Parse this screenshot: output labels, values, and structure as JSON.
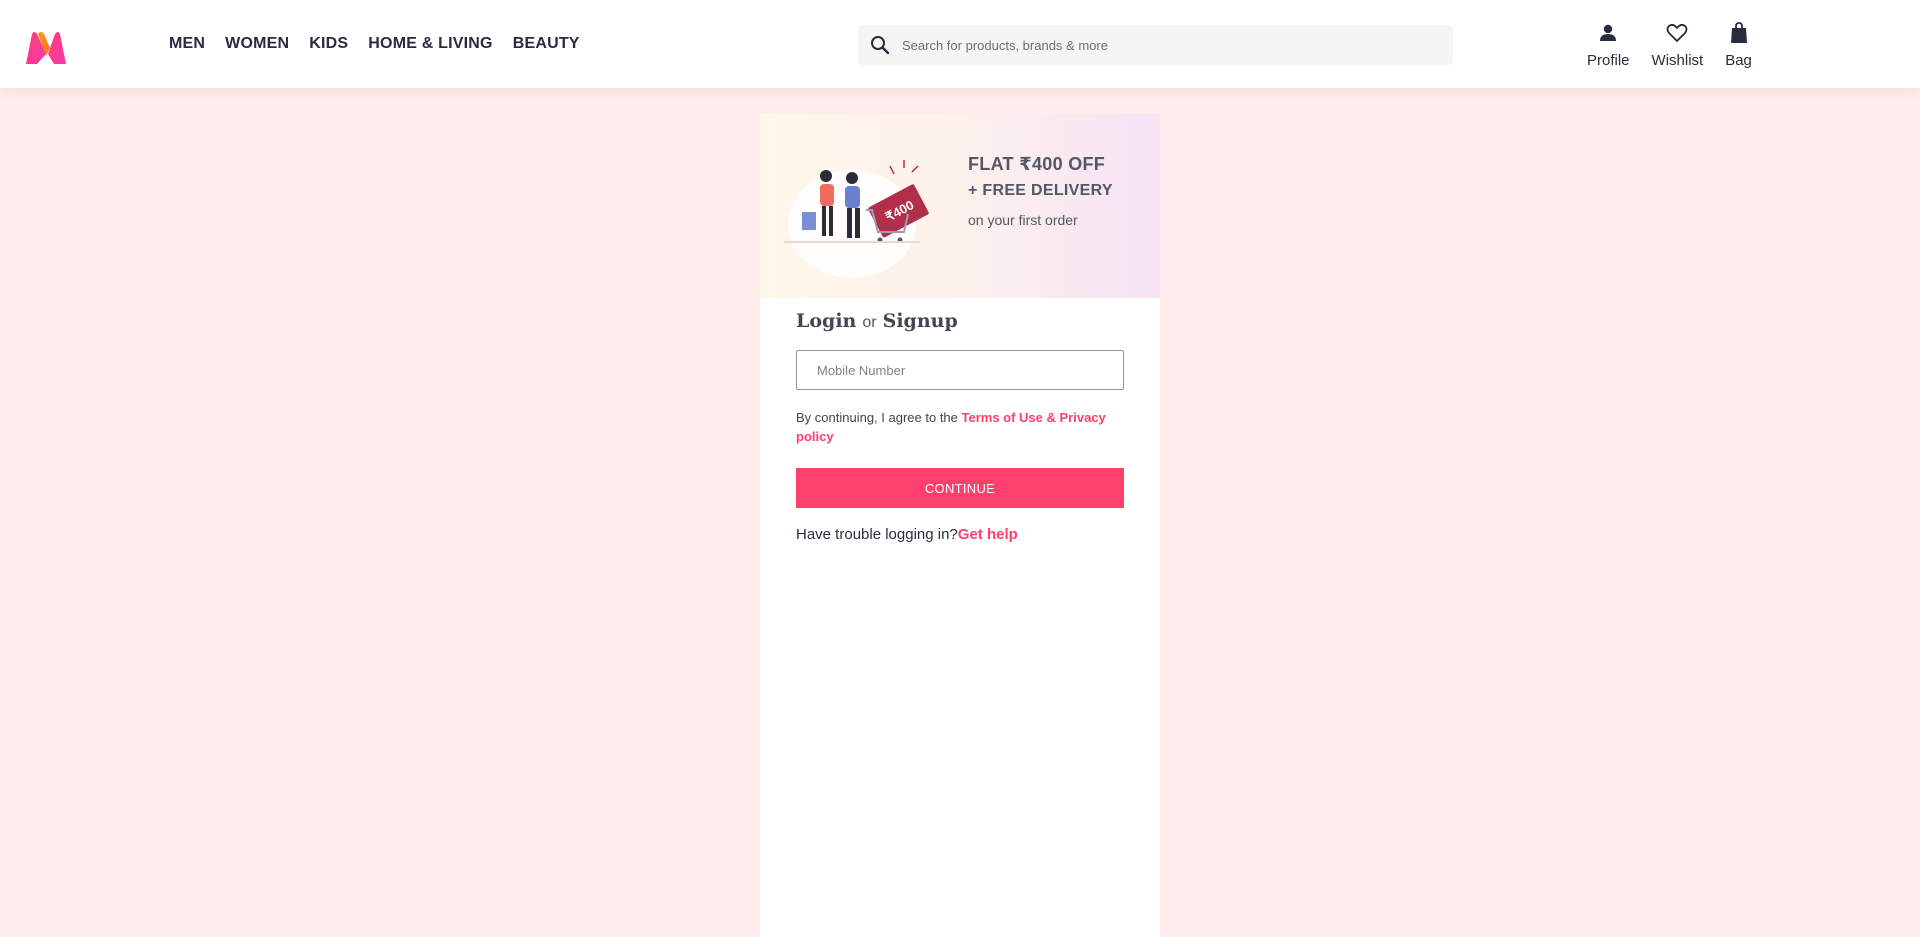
{
  "header": {
    "logo_icon": "myntra-logo-icon",
    "nav": [
      {
        "label": "MEN"
      },
      {
        "label": "WOMEN"
      },
      {
        "label": "KIDS"
      },
      {
        "label": "HOME & LIVING"
      },
      {
        "label": "BEAUTY"
      }
    ],
    "search": {
      "icon": "search-icon",
      "placeholder": "Search for products, brands & more"
    },
    "actions": [
      {
        "label": "Profile",
        "icon": "profile-icon"
      },
      {
        "label": "Wishlist",
        "icon": "heart-icon"
      },
      {
        "label": "Bag",
        "icon": "bag-icon"
      }
    ]
  },
  "banner": {
    "line1": "FLAT  ₹400 OFF",
    "line2": "+ FREE DELIVERY",
    "line3": "on your first order",
    "tag_text": "₹400"
  },
  "login": {
    "title_login": "Login",
    "title_or": "or",
    "title_signup": "Signup",
    "mobile_placeholder": "Mobile Number",
    "terms_prefix": "By continuing, I agree to the ",
    "terms_link": "Terms of Use & Privacy policy",
    "continue_label": "CONTINUE",
    "trouble_text": "Have trouble logging in?",
    "help_link": "Get help"
  },
  "colors": {
    "accent": "#ff3f6c",
    "page_bg": "#ffeded",
    "text": "#282c3f"
  }
}
